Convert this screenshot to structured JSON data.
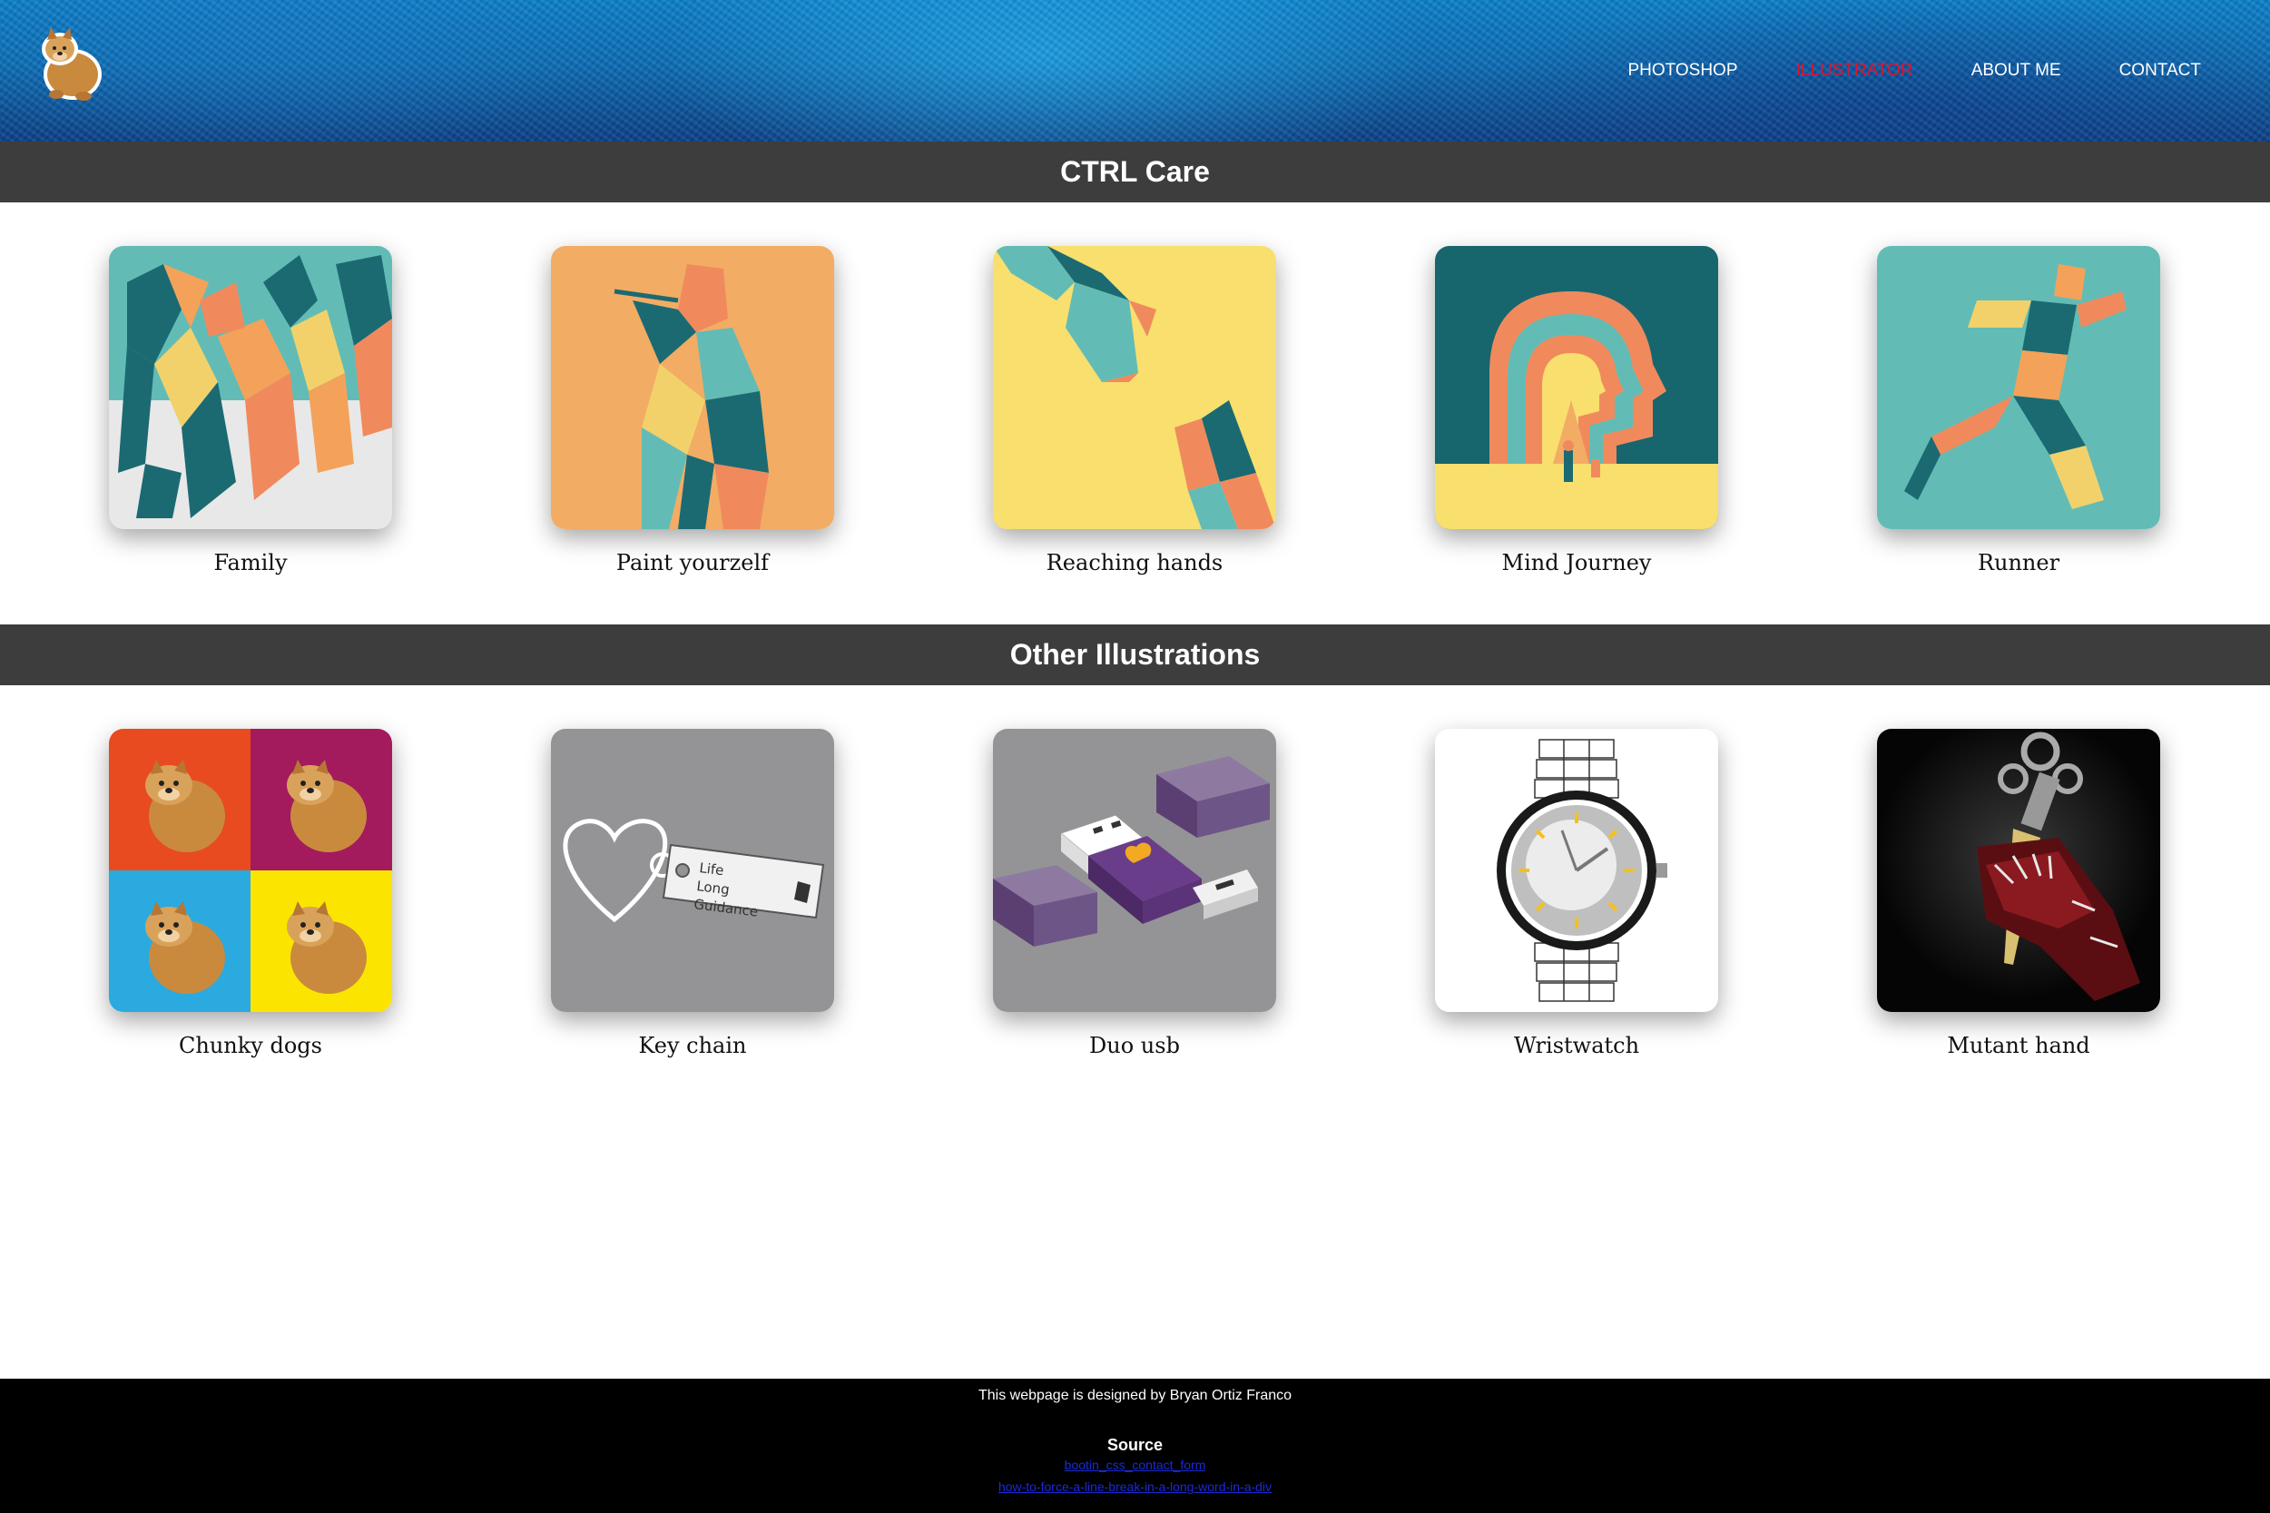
{
  "nav": {
    "items": [
      {
        "label": "PHOTOSHOP",
        "active": false
      },
      {
        "label": "ILLUSTRATOR",
        "active": true
      },
      {
        "label": "ABOUT ME",
        "active": false
      },
      {
        "label": "CONTACT",
        "active": false
      }
    ],
    "active_color": "#e0132a"
  },
  "sections": [
    {
      "title": "CTRL Care",
      "items": [
        {
          "caption": "Family",
          "icon": "family-illustration"
        },
        {
          "caption": "Paint yourzelf",
          "icon": "paint-yourzelf-illustration"
        },
        {
          "caption": "Reaching hands",
          "icon": "reaching-hands-illustration"
        },
        {
          "caption": "Mind Journey",
          "icon": "mind-journey-illustration"
        },
        {
          "caption": "Runner",
          "icon": "runner-illustration"
        }
      ]
    },
    {
      "title": "Other Illustrations",
      "items": [
        {
          "caption": "Chunky dogs",
          "icon": "chunky-dogs-illustration"
        },
        {
          "caption": "Key chain",
          "icon": "key-chain-illustration",
          "tag_text": [
            "Life",
            "Long",
            "Guidance"
          ]
        },
        {
          "caption": "Duo usb",
          "icon": "duo-usb-illustration"
        },
        {
          "caption": "Wristwatch",
          "icon": "wristwatch-illustration"
        },
        {
          "caption": "Mutant hand",
          "icon": "mutant-hand-illustration"
        }
      ]
    }
  ],
  "footer": {
    "credit": "This webpage is designed by Bryan Ortiz Franco",
    "source_title": "Source",
    "links": [
      "bootin_css_contact_form",
      "how-to-force-a-line-break-in-a-long-word-in-a-div"
    ]
  },
  "colors": {
    "header_blue": "#0a6cb4",
    "section_bar": "#3d3d3d",
    "footer_bg": "#000000",
    "link": "#1a2bd8"
  }
}
